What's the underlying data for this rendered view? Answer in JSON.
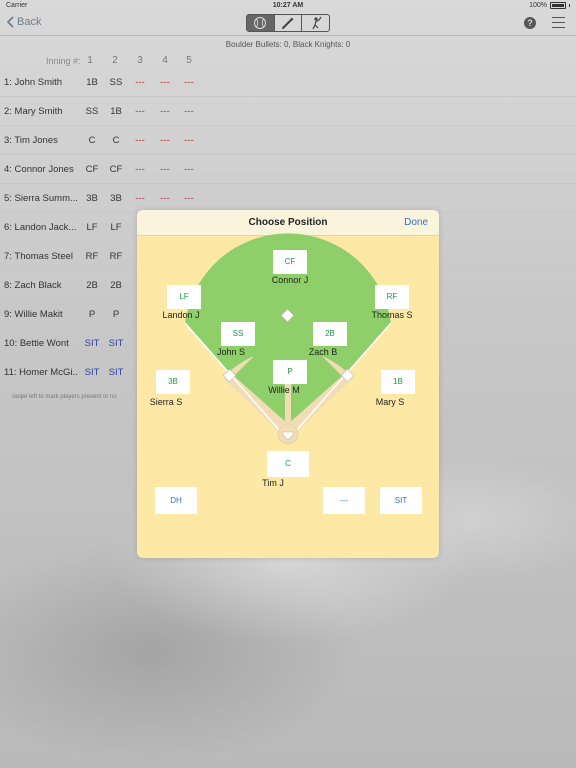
{
  "status": {
    "carrier": "Carrier",
    "time": "10:27 AM",
    "battery": "100%"
  },
  "nav": {
    "back_label": "Back",
    "segments": [
      "baseball-icon",
      "bat-icon",
      "batter-icon"
    ],
    "help_label": "?"
  },
  "score": "Boulder Bullets: 0, Black Knights: 0",
  "innings": {
    "label": "Inning #:",
    "numbers": [
      "1",
      "2",
      "3",
      "4",
      "5"
    ]
  },
  "lineup": [
    {
      "name": "1: John Smith",
      "positions": [
        "1B",
        "SS",
        "---",
        "---",
        "---"
      ]
    },
    {
      "name": "2: Mary Smith",
      "positions": [
        "SS",
        "1B",
        "---",
        "---",
        "---"
      ]
    },
    {
      "name": "3: Tim Jones",
      "positions": [
        "C",
        "C",
        "---",
        "---",
        "---"
      ]
    },
    {
      "name": "4: Connor Jones",
      "positions": [
        "CF",
        "CF",
        "---",
        "---",
        "---"
      ]
    },
    {
      "name": "5: Sierra Summ...",
      "positions": [
        "3B",
        "3B",
        "---",
        "---",
        "---"
      ]
    },
    {
      "name": "6: Landon Jack...",
      "positions": [
        "LF",
        "LF",
        "-",
        "",
        ""
      ]
    },
    {
      "name": "7: Thomas Steel",
      "positions": [
        "RF",
        "RF",
        "-",
        "",
        ""
      ]
    },
    {
      "name": "8: Zach Black",
      "positions": [
        "2B",
        "2B",
        "-",
        "",
        ""
      ]
    },
    {
      "name": "9: Willie Makit",
      "positions": [
        "P",
        "P",
        "-",
        "",
        ""
      ]
    },
    {
      "name": "10: Bettie Wont",
      "positions": [
        "SIT",
        "SIT",
        "-",
        "",
        ""
      ]
    },
    {
      "name": "11: Homer McGi...",
      "positions": [
        "SIT",
        "SIT",
        "-",
        "",
        ""
      ]
    }
  ],
  "swipe_hint": "swipe left to mark players present or no",
  "modal": {
    "title": "Choose Position",
    "done_label": "Done",
    "positions": {
      "cf": {
        "code": "CF",
        "player": "Connor J"
      },
      "lf": {
        "code": "LF",
        "player": "Landon J"
      },
      "rf": {
        "code": "RF",
        "player": "Thomas S"
      },
      "ss": {
        "code": "SS",
        "player": "John S"
      },
      "2b": {
        "code": "2B",
        "player": "Zach B"
      },
      "3b": {
        "code": "3B",
        "player": "Sierra S"
      },
      "1b": {
        "code": "1B",
        "player": "Mary S"
      },
      "p": {
        "code": "P",
        "player": "Willie M"
      },
      "c": {
        "code": "C",
        "player": "Tim J"
      },
      "dh": {
        "code": "DH"
      },
      "none": {
        "code": "---"
      },
      "sit": {
        "code": "SIT"
      }
    }
  },
  "colors": {
    "outfield_grass": "#8fcf6a",
    "infield_dirt": "#f2dcb6",
    "modal_bg": "#fde9a5",
    "position_text": "#1d9b4a",
    "action_text": "#2f6fd6",
    "sit_text": "#3140a8",
    "empty_text": "#b03030"
  }
}
